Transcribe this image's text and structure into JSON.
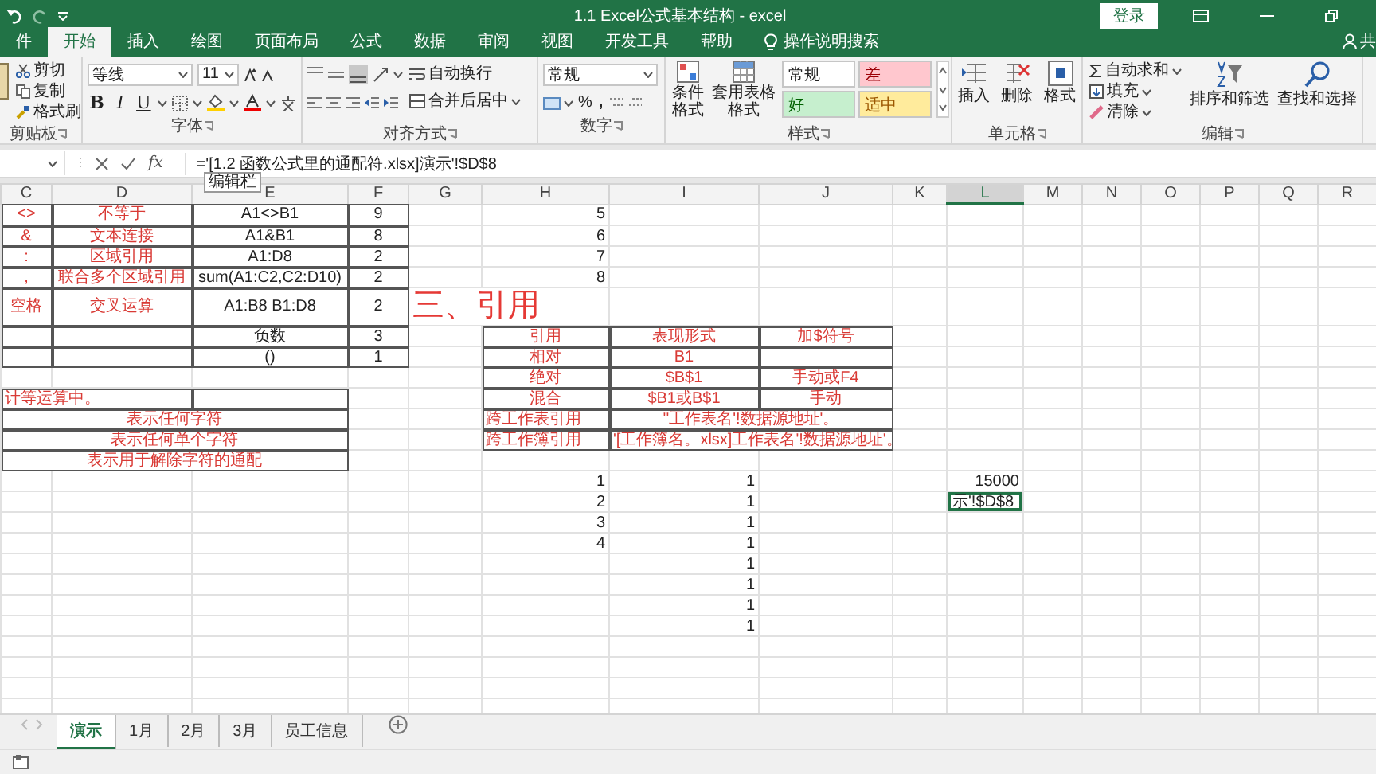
{
  "title_bar": {
    "title": "1.1 Excel公式基本结构 - excel",
    "sign_in": "登录"
  },
  "ribbon_tabs": [
    {
      "label": "件",
      "selected": false
    },
    {
      "label": "开始",
      "selected": true
    },
    {
      "label": "插入",
      "selected": false
    },
    {
      "label": "绘图",
      "selected": false
    },
    {
      "label": "页面布局",
      "selected": false
    },
    {
      "label": "公式",
      "selected": false
    },
    {
      "label": "数据",
      "selected": false
    },
    {
      "label": "审阅",
      "selected": false
    },
    {
      "label": "视图",
      "selected": false
    },
    {
      "label": "开发工具",
      "selected": false
    },
    {
      "label": "帮助",
      "selected": false
    }
  ],
  "tell_me": "操作说明搜索",
  "share": "共",
  "ribbon": {
    "clipboard": {
      "label": "剪贴板",
      "items": [
        "剪切",
        "复制",
        "格式刷"
      ]
    },
    "font": {
      "label": "字体",
      "font_name": "等线",
      "font_size": "11",
      "style_buttons": [
        "B",
        "I",
        "U"
      ]
    },
    "alignment": {
      "label": "对齐方式",
      "wrap": "自动换行",
      "merge": "合并后居中"
    },
    "number": {
      "label": "数字",
      "format": "常规",
      "percent": "%",
      "comma": ","
    },
    "styles": {
      "label": "样式",
      "conditional": "条件格式",
      "table": "套用表格格式",
      "gallery": [
        {
          "label": "常规",
          "kind": "normal"
        },
        {
          "label": "差",
          "kind": "bad"
        },
        {
          "label": "好",
          "kind": "good"
        },
        {
          "label": "适中",
          "kind": "neutral"
        }
      ]
    },
    "cells": {
      "label": "单元格",
      "items": [
        "插入",
        "删除",
        "格式"
      ]
    },
    "editing": {
      "label": "编辑",
      "autosum": "自动求和",
      "fill": "填充",
      "clear": "清除",
      "sort": "排序和筛选",
      "find": "查找和选择"
    }
  },
  "formula_bar": {
    "fx": "fx",
    "formula": "='[1.2 函数公式里的通配符.xlsx]演示'!$D$8"
  },
  "tooltip": "编辑栏",
  "sheet": {
    "columns": [
      {
        "label": "C",
        "selected": false
      },
      {
        "label": "D",
        "selected": false
      },
      {
        "label": "E",
        "selected": false
      },
      {
        "label": "F",
        "selected": false
      },
      {
        "label": "G",
        "selected": false
      },
      {
        "label": "H",
        "selected": false
      },
      {
        "label": "I",
        "selected": false
      },
      {
        "label": "J",
        "selected": false
      },
      {
        "label": "K",
        "selected": false
      },
      {
        "label": "L",
        "selected": true
      },
      {
        "label": "M",
        "selected": false
      },
      {
        "label": "N",
        "selected": false
      },
      {
        "label": "O",
        "selected": false
      },
      {
        "label": "P",
        "selected": false
      },
      {
        "label": "Q",
        "selected": false
      },
      {
        "label": "R",
        "selected": false
      }
    ],
    "rows": [
      {
        "cells": [
          {
            "text": "<>",
            "kind": "label",
            "bordered": true,
            "selected": false
          },
          {
            "text": "不等于",
            "kind": "label",
            "bordered": true,
            "selected": false
          },
          {
            "text": "A1<>B1",
            "kind": "value",
            "bordered": true,
            "selected": false
          },
          {
            "text": "9",
            "kind": "value",
            "bordered": true,
            "selected": false
          },
          {
            "text": "",
            "bordered": false,
            "selected": false
          },
          {
            "text": "5",
            "kind": "number",
            "bordered": false,
            "selected": false
          }
        ]
      },
      {
        "cells": [
          {
            "text": "&",
            "kind": "label",
            "bordered": true,
            "selected": false
          },
          {
            "text": "文本连接",
            "kind": "label",
            "bordered": true,
            "selected": false
          },
          {
            "text": "A1&B1",
            "kind": "value",
            "bordered": true,
            "selected": false
          },
          {
            "text": "8",
            "kind": "value",
            "bordered": true,
            "selected": false
          },
          {
            "text": "",
            "bordered": false,
            "selected": false
          },
          {
            "text": "6",
            "kind": "number",
            "bordered": false,
            "selected": false
          }
        ]
      },
      {
        "cells": [
          {
            "text": ":",
            "kind": "label",
            "bordered": true,
            "selected": false
          },
          {
            "text": "区域引用",
            "kind": "label",
            "bordered": true,
            "selected": false
          },
          {
            "text": "A1:D8",
            "kind": "value",
            "bordered": true,
            "selected": false
          },
          {
            "text": "2",
            "kind": "value",
            "bordered": true,
            "selected": false
          },
          {
            "text": "",
            "bordered": false,
            "selected": false
          },
          {
            "text": "7",
            "kind": "number",
            "bordered": false,
            "selected": false
          }
        ]
      },
      {
        "cells": [
          {
            "text": ",",
            "kind": "label",
            "bordered": true,
            "selected": false
          },
          {
            "text": "联合多个区域引用",
            "kind": "label",
            "bordered": true,
            "selected": false
          },
          {
            "text": "sum(A1:C2,C2:D10)",
            "kind": "value",
            "bordered": true,
            "selected": false
          },
          {
            "text": "2",
            "kind": "value",
            "bordered": true,
            "selected": false
          },
          {
            "text": "",
            "bordered": false,
            "selected": false
          },
          {
            "text": "8",
            "kind": "number",
            "bordered": false,
            "selected": false
          }
        ]
      },
      {
        "cells": [
          {
            "text": "空格",
            "kind": "label",
            "bordered": true,
            "selected": false
          },
          {
            "text": "交叉运算",
            "kind": "label",
            "bordered": true,
            "selected": false
          },
          {
            "text": "A1:B8 B1:D8",
            "kind": "value",
            "bordered": true,
            "selected": false
          },
          {
            "text": "2",
            "kind": "value",
            "bordered": true,
            "selected": false
          },
          {
            "text": "三、引用",
            "kind": "title",
            "colspan": 2,
            "bordered": false,
            "selected": false
          }
        ]
      },
      {
        "cells": [
          {
            "text": "",
            "bordered": true,
            "selected": false
          },
          {
            "text": "",
            "bordered": true,
            "selected": false
          },
          {
            "text": "负数",
            "kind": "value",
            "bordered": true,
            "selected": false
          },
          {
            "text": "3",
            "kind": "value",
            "bordered": true,
            "selected": false
          },
          {
            "text": "",
            "bordered": false,
            "selected": false
          },
          {
            "text": "引用",
            "kind": "label",
            "bordered": true,
            "selected": false
          },
          {
            "text": "表现形式",
            "kind": "label",
            "bordered": true,
            "selected": false
          },
          {
            "text": "加$符号",
            "kind": "label",
            "bordered": true,
            "selected": false
          }
        ]
      },
      {
        "cells": [
          {
            "text": "",
            "bordered": true,
            "selected": false
          },
          {
            "text": "",
            "bordered": true,
            "selected": false
          },
          {
            "text": "()",
            "kind": "value",
            "bordered": true,
            "selected": false
          },
          {
            "text": "1",
            "kind": "value",
            "bordered": true,
            "selected": false
          },
          {
            "text": "",
            "bordered": false,
            "selected": false
          },
          {
            "text": "相对",
            "kind": "label",
            "bordered": true,
            "selected": false
          },
          {
            "text": "B1",
            "kind": "label",
            "bordered": true,
            "selected": false
          },
          {
            "text": "",
            "bordered": true,
            "selected": false
          }
        ]
      },
      {
        "cells": [
          {
            "text": "",
            "bordered": false,
            "selected": false
          },
          {
            "text": "",
            "bordered": false,
            "selected": false
          },
          {
            "text": "",
            "bordered": false,
            "selected": false
          },
          {
            "text": "",
            "bordered": false,
            "selected": false
          },
          {
            "text": "",
            "bordered": false,
            "selected": false
          },
          {
            "text": "绝对",
            "kind": "label",
            "bordered": true,
            "selected": false
          },
          {
            "text": "$B$1",
            "kind": "label",
            "bordered": true,
            "selected": false
          },
          {
            "text": "手动或F4",
            "kind": "label",
            "bordered": true,
            "selected": false
          }
        ]
      },
      {
        "cells": [
          {
            "text": "计等运算中。",
            "kind": "label_left",
            "colspan": 2,
            "bordered": true,
            "selected": false
          },
          {
            "text": "",
            "bordered": true,
            "selected": false
          },
          {
            "text": "",
            "bordered": false,
            "selected": false
          },
          {
            "text": "",
            "bordered": false,
            "selected": false
          },
          {
            "text": "混合",
            "kind": "label",
            "bordered": true,
            "selected": false
          },
          {
            "text": "$B1或B$1",
            "kind": "label",
            "bordered": true,
            "selected": false
          },
          {
            "text": "手动",
            "kind": "label",
            "bordered": true,
            "selected": false
          }
        ]
      },
      {
        "cells": [
          {
            "text": "表示任何字符",
            "kind": "label",
            "colspan": 3,
            "bordered": true,
            "selected": false
          },
          {
            "text": "",
            "bordered": false,
            "selected": false
          },
          {
            "text": "",
            "bordered": false,
            "selected": false
          },
          {
            "text": "跨工作表引用",
            "kind": "label_left",
            "bordered": true,
            "selected": false
          },
          {
            "text": "''工作表名'!数据源地址'。",
            "kind": "label",
            "colspan": 2,
            "bordered": true,
            "selected": false
          }
        ]
      },
      {
        "cells": [
          {
            "text": "表示任何单个字符",
            "kind": "label",
            "colspan": 3,
            "bordered": true,
            "selected": false
          },
          {
            "text": "",
            "bordered": false,
            "selected": false
          },
          {
            "text": "",
            "bordered": false,
            "selected": false
          },
          {
            "text": "跨工作簿引用",
            "kind": "label_left",
            "bordered": true,
            "selected": false
          },
          {
            "text": "'[工作簿名。xlsx]工作表名'!数据源地址'。",
            "kind": "label",
            "colspan": 2,
            "bordered": true,
            "selected": false
          }
        ]
      },
      {
        "cells": [
          {
            "text": "表示用于解除字符的通配",
            "kind": "label",
            "colspan": 3,
            "bordered": true,
            "selected": false
          }
        ]
      },
      {
        "cells": [
          {
            "text": "",
            "bordered": false,
            "selected": false
          },
          {
            "text": "",
            "bordered": false,
            "selected": false
          },
          {
            "text": "",
            "bordered": false,
            "selected": false
          },
          {
            "text": "",
            "bordered": false,
            "selected": false
          },
          {
            "text": "",
            "bordered": false,
            "selected": false
          },
          {
            "text": "1",
            "kind": "number",
            "bordered": false,
            "selected": false
          },
          {
            "text": "1",
            "kind": "number",
            "bordered": false,
            "selected": false
          },
          {
            "text": "",
            "bordered": false,
            "selected": false
          },
          {
            "text": "",
            "bordered": false,
            "selected": false
          },
          {
            "text": "15000",
            "kind": "number",
            "bordered": false,
            "selected": false
          }
        ]
      },
      {
        "cells": [
          {
            "text": "",
            "bordered": false,
            "selected": false
          },
          {
            "text": "",
            "bordered": false,
            "selected": false
          },
          {
            "text": "",
            "bordered": false,
            "selected": false
          },
          {
            "text": "",
            "bordered": false,
            "selected": false
          },
          {
            "text": "",
            "bordered": false,
            "selected": false
          },
          {
            "text": "2",
            "kind": "number",
            "bordered": false,
            "selected": false
          },
          {
            "text": "1",
            "kind": "number",
            "bordered": false,
            "selected": false
          },
          {
            "text": "",
            "bordered": false,
            "selected": false
          },
          {
            "text": "",
            "bordered": false,
            "selected": false
          },
          {
            "text": "示'!$D$8",
            "kind": "reference",
            "bordered": false,
            "selected": true
          }
        ]
      },
      {
        "cells": [
          {
            "text": "",
            "bordered": false,
            "selected": false
          },
          {
            "text": "",
            "bordered": false,
            "selected": false
          },
          {
            "text": "",
            "bordered": false,
            "selected": false
          },
          {
            "text": "",
            "bordered": false,
            "selected": false
          },
          {
            "text": "",
            "bordered": false,
            "selected": false
          },
          {
            "text": "3",
            "kind": "number",
            "bordered": false,
            "selected": false
          },
          {
            "text": "1",
            "kind": "number",
            "bordered": false,
            "selected": false
          }
        ]
      },
      {
        "cells": [
          {
            "text": "",
            "bordered": false,
            "selected": false
          },
          {
            "text": "",
            "bordered": false,
            "selected": false
          },
          {
            "text": "",
            "bordered": false,
            "selected": false
          },
          {
            "text": "",
            "bordered": false,
            "selected": false
          },
          {
            "text": "",
            "bordered": false,
            "selected": false
          },
          {
            "text": "4",
            "kind": "number",
            "bordered": false,
            "selected": false
          },
          {
            "text": "1",
            "kind": "number",
            "bordered": false,
            "selected": false
          }
        ]
      },
      {
        "cells": [
          {
            "text": "",
            "bordered": false,
            "selected": false
          },
          {
            "text": "",
            "bordered": false,
            "selected": false
          },
          {
            "text": "",
            "bordered": false,
            "selected": false
          },
          {
            "text": "",
            "bordered": false,
            "selected": false
          },
          {
            "text": "",
            "bordered": false,
            "selected": false
          },
          {
            "text": "",
            "bordered": false,
            "selected": false
          },
          {
            "text": "1",
            "kind": "number",
            "bordered": false,
            "selected": false
          }
        ]
      },
      {
        "cells": [
          {
            "text": "",
            "bordered": false,
            "selected": false
          },
          {
            "text": "",
            "bordered": false,
            "selected": false
          },
          {
            "text": "",
            "bordered": false,
            "selected": false
          },
          {
            "text": "",
            "bordered": false,
            "selected": false
          },
          {
            "text": "",
            "bordered": false,
            "selected": false
          },
          {
            "text": "",
            "bordered": false,
            "selected": false
          },
          {
            "text": "1",
            "kind": "number",
            "bordered": false,
            "selected": false
          }
        ]
      },
      {
        "cells": [
          {
            "text": "",
            "bordered": false,
            "selected": false
          },
          {
            "text": "",
            "bordered": false,
            "selected": false
          },
          {
            "text": "",
            "bordered": false,
            "selected": false
          },
          {
            "text": "",
            "bordered": false,
            "selected": false
          },
          {
            "text": "",
            "bordered": false,
            "selected": false
          },
          {
            "text": "",
            "bordered": false,
            "selected": false
          },
          {
            "text": "1",
            "kind": "number",
            "bordered": false,
            "selected": false
          }
        ]
      },
      {
        "cells": [
          {
            "text": "",
            "bordered": false,
            "selected": false
          },
          {
            "text": "",
            "bordered": false,
            "selected": false
          },
          {
            "text": "",
            "bordered": false,
            "selected": false
          },
          {
            "text": "",
            "bordered": false,
            "selected": false
          },
          {
            "text": "",
            "bordered": false,
            "selected": false
          },
          {
            "text": "",
            "bordered": false,
            "selected": false
          },
          {
            "text": "1",
            "kind": "number",
            "bordered": false,
            "selected": false
          }
        ]
      }
    ]
  },
  "sheet_tabs": [
    {
      "label": "演示",
      "selected": true
    },
    {
      "label": "1月",
      "selected": false
    },
    {
      "label": "2月",
      "selected": false
    },
    {
      "label": "3月",
      "selected": false
    },
    {
      "label": "员工信息",
      "selected": false
    }
  ]
}
